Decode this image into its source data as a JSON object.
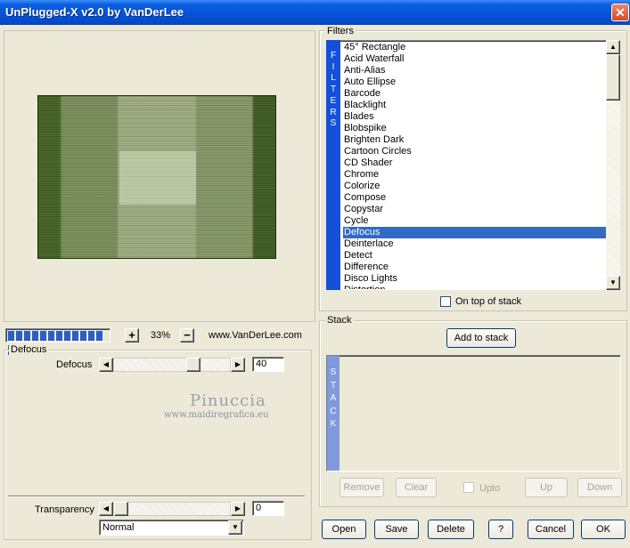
{
  "window": {
    "title": "UnPlugged-X v2.0 by VanDerLee",
    "close_glyph": "✕"
  },
  "preview": {
    "zoom": "33%",
    "zoom_plus": "+",
    "zoom_minus": "−",
    "website": "www.VanDerLee.com",
    "progress_segments": 13
  },
  "watermark": {
    "name": "Pinuccia",
    "url": "www.maidiregrafica.eu"
  },
  "defocus_group": {
    "title": "Defocus",
    "param_label": "Defocus",
    "param_value": "40",
    "param_level": 0.4,
    "transparency_label": "Transparency",
    "transparency_value": "0",
    "transparency_level": 0,
    "blend_mode": "Normal"
  },
  "filters": {
    "title": "Filters",
    "strip_label": [
      "F",
      "I",
      "L",
      "T",
      "E",
      "R",
      "S"
    ],
    "items": [
      "45° Rectangle",
      "Acid Waterfall",
      "Anti-Alias",
      "Auto Ellipse",
      "Barcode",
      "Blacklight",
      "Blades",
      "Blobspike",
      "Brighten Dark",
      "Cartoon Circles",
      "CD Shader",
      "Chrome",
      "Colorize",
      "Compose",
      "Copystar",
      "Cycle",
      "Defocus",
      "Deinterlace",
      "Detect",
      "Difference",
      "Disco Lights",
      "Distortion"
    ],
    "selected": "Defocus",
    "on_top_label": "On top of stack"
  },
  "stack": {
    "title": "Stack",
    "add_button": "Add to stack",
    "strip_label": [
      "S",
      "T",
      "A",
      "C",
      "K"
    ],
    "remove": "Remove",
    "clear": "Clear",
    "upto": "Upto",
    "up": "Up",
    "down": "Down"
  },
  "footer": {
    "open": "Open",
    "save": "Save",
    "delete": "Delete",
    "help": "?",
    "cancel": "Cancel",
    "ok": "OK"
  },
  "colors": {
    "titlebar": "#0453d8",
    "selection": "#316ac5",
    "filters_strip": "#1450d8",
    "stack_strip": "#7f9ade",
    "dialog_bg": "#ece9d8"
  }
}
